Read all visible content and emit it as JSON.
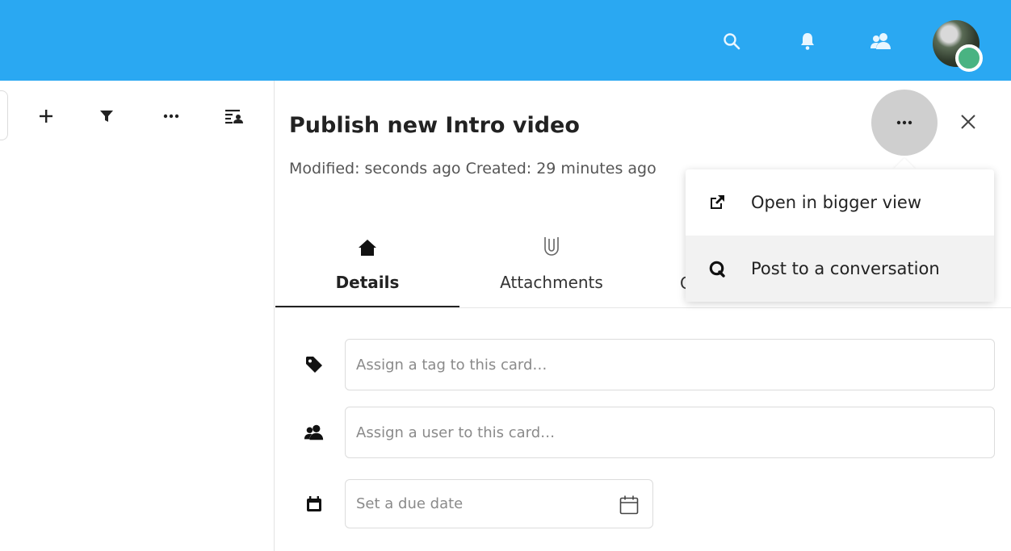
{
  "header": {
    "icons": [
      "search-icon",
      "bell-icon",
      "contacts-icon",
      "avatar"
    ],
    "accent": "#2aa8f2",
    "status_color": "#49b382"
  },
  "left_toolbar": {
    "icons": [
      "plus-icon",
      "filter-icon",
      "more-icon",
      "view-toggle-icon"
    ]
  },
  "card": {
    "title": "Publish new Intro video",
    "meta": "Modified: seconds ago Created: 29 minutes ago"
  },
  "tabs": [
    {
      "label": "Details",
      "icon": "home-icon",
      "active": true
    },
    {
      "label": "Attachments",
      "icon": "paperclip-icon",
      "active": false
    }
  ],
  "tab_partial": "C",
  "fields": {
    "tag_placeholder": "Assign a tag to this card…",
    "user_placeholder": "Assign a user to this card…",
    "date_placeholder": "Set a due date"
  },
  "menu": {
    "items": [
      {
        "label": "Open in bigger view",
        "icon": "external-link-icon"
      },
      {
        "label": "Post to a conversation",
        "icon": "talk-icon"
      }
    ]
  }
}
